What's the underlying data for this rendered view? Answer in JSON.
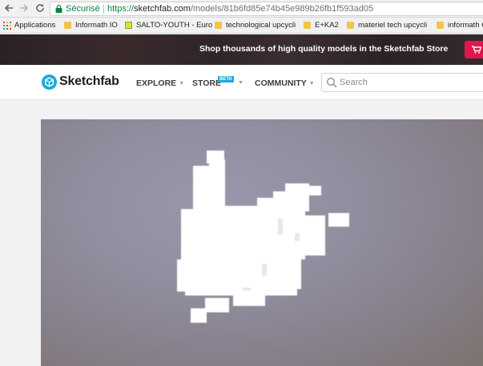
{
  "browser": {
    "back_icon": "arrow-left-icon",
    "forward_icon": "arrow-right-icon",
    "reload_icon": "reload-icon",
    "secure_label": "Sécurisé",
    "url_scheme": "https://",
    "url_host": "sketchfab.com",
    "url_path": "/models/81b6fd85e74b45e989b26fb1f593ad05",
    "bookmarks": [
      {
        "label": "Applications",
        "icon": "apps-grid-icon"
      },
      {
        "label": "Informath IO",
        "icon": "folder-icon"
      },
      {
        "label": "SALTO-YOUTH - Euro",
        "icon": "salto-icon"
      },
      {
        "label": "technological upcycli",
        "icon": "folder-icon"
      },
      {
        "label": "E+KA2",
        "icon": "folder-icon"
      },
      {
        "label": "materiel tech upcycli",
        "icon": "folder-icon"
      },
      {
        "label": "informath C",
        "icon": "folder-icon"
      }
    ]
  },
  "promo": {
    "text": "Shop thousands of high quality models in the Sketchfab Store",
    "button_icon": "cart-icon",
    "accent": "#e2164f"
  },
  "header": {
    "logo_text": "Sketchfab",
    "logo_color": "#1caad9",
    "nav": {
      "explore": "EXPLORE",
      "store": "STORE",
      "store_badge": "BETA",
      "community": "COMMUNITY"
    },
    "search_placeholder": "Search"
  },
  "viewer": {
    "model_color": "#ffffff"
  }
}
